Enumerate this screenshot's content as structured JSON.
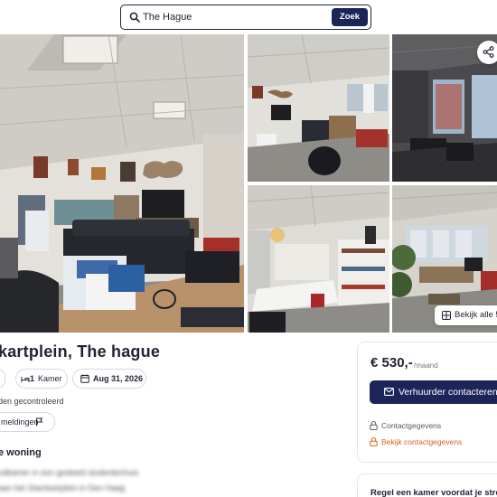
{
  "search": {
    "value": "The Hague",
    "button_label": "Zoek"
  },
  "gallery": {
    "all_photos_label": "Bekijk alle 5"
  },
  "listing": {
    "title": "kartplein, The hague",
    "chip_partial": "",
    "rooms_count": "1",
    "rooms_label": "Kamer",
    "date": "Aug 31, 2026",
    "verified_text": "den gecontroleerd",
    "report_label": "meldingen",
    "section_title": "e woning",
    "blurred_line_1": "udkamer in een gedeeld studentenhuis",
    "blurred_line_2": "aan het Stamkartplein in Den Haag"
  },
  "price_card": {
    "price": "€ 530,-",
    "per": "/maand",
    "contact_button": "Verhuurder contacteren",
    "contact_info_label": "Contactgegevens",
    "view_contact_label": "Bekijk contactgegevens"
  },
  "rent_card": {
    "title": "Regel een kamer voordat je stree"
  },
  "colors": {
    "primary": "#1c2557",
    "accent_orange": "#d9601e",
    "text": "#1f2333"
  },
  "icons": {
    "search": "search-icon",
    "share": "share-icon",
    "grid": "grid-icon",
    "bed": "bed-icon",
    "calendar": "calendar-icon",
    "flag": "flag-icon",
    "mail": "mail-icon",
    "lock": "lock-icon"
  }
}
